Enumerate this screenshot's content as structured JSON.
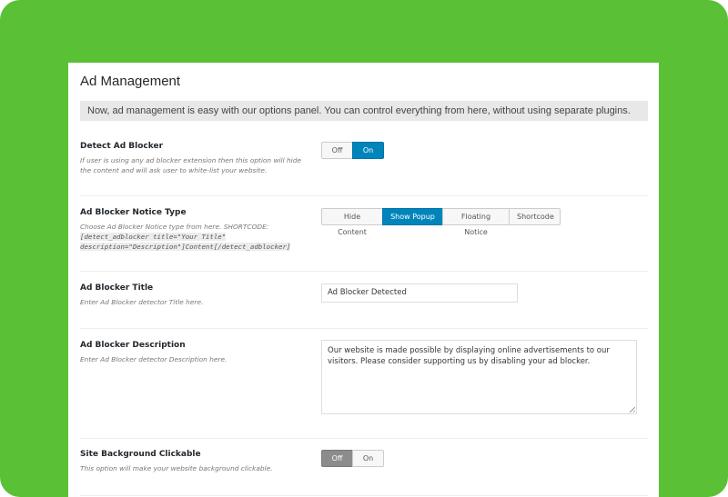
{
  "panel": {
    "title": "Ad Management",
    "notice": "Now, ad management is easy with our options panel. You can control everything from here, without using separate plugins."
  },
  "detect_ad_blocker": {
    "label": "Detect Ad Blocker",
    "description": "If user is using any ad blocker extension then this option will hide the content and will ask user to white-list your website.",
    "options": [
      "Off",
      "On"
    ],
    "selected": "On"
  },
  "notice_type": {
    "label": "Ad Blocker Notice Type",
    "description": "Choose Ad Blocker Notice type from here. SHORTCODE:",
    "shortcode_line1": "[detect_adblocker title=\"Your Title\"",
    "shortcode_line2": "description=\"Description\"]Content[/detect_adblocker]",
    "options": [
      "Hide Content",
      "Show Popup",
      "Floating Notice",
      "Shortcode"
    ],
    "selected": "Show Popup"
  },
  "title_field": {
    "label": "Ad Blocker Title",
    "description": "Enter Ad Blocker detector Title here.",
    "value": "Ad Blocker Detected"
  },
  "description_field": {
    "label": "Ad Blocker Description",
    "description": "Enter Ad Blocker detector Description here.",
    "value": "Our website is made possible by displaying online advertisements to our visitors. Please consider supporting us by disabling your ad blocker."
  },
  "background_clickable": {
    "label": "Site Background Clickable",
    "description": "This option will make your website background clickable.",
    "options": [
      "Off",
      "On"
    ],
    "selected": "Off"
  },
  "colors": {
    "background_green": "#5ac036",
    "active_blue": "#0085ba",
    "active_grey": "#8c8c8c"
  }
}
